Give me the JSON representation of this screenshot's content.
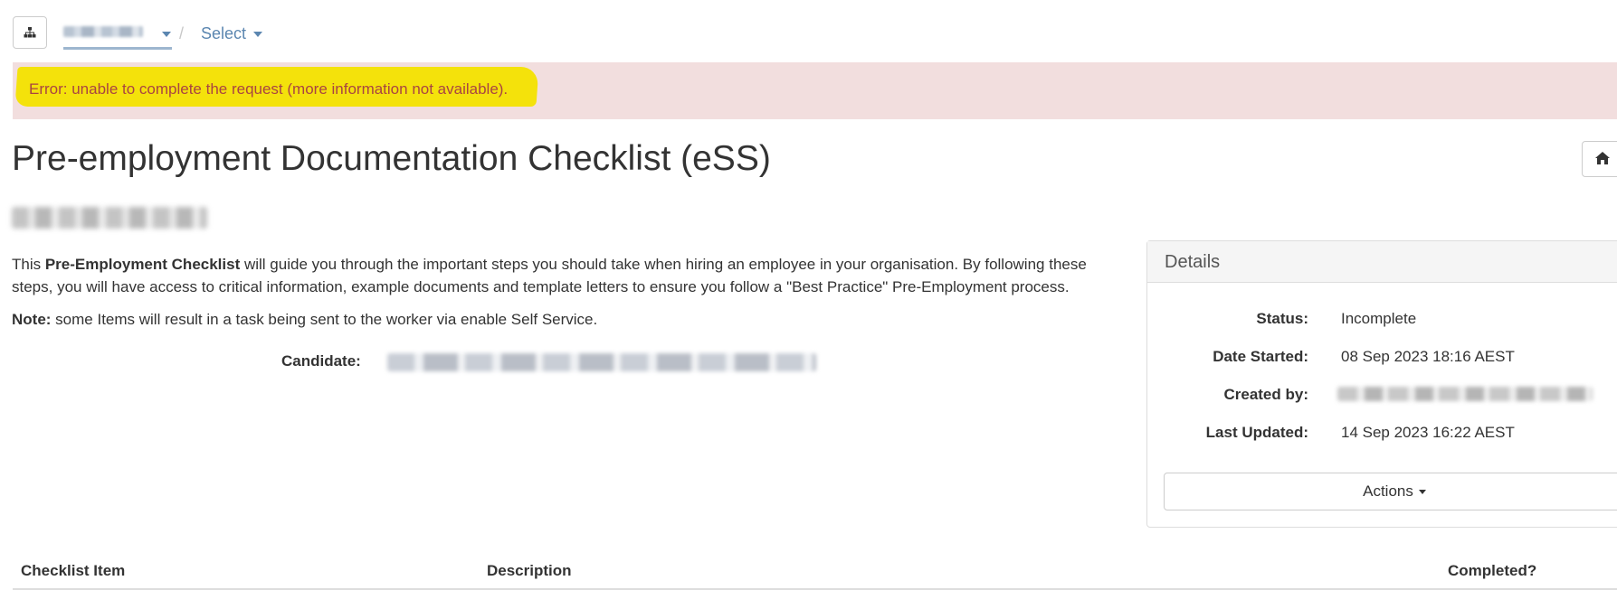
{
  "icons": {
    "org": "sitemap-icon",
    "home": "home-icon",
    "crumb_caret": "caret-down-icon",
    "actions_caret": "caret-down-icon"
  },
  "breadcrumb": {
    "separator": "/",
    "select_label": "Select"
  },
  "alert": {
    "message": "Error: unable to complete the request (more information not available)."
  },
  "page": {
    "title": "Pre-employment Documentation Checklist (eSS)"
  },
  "intro": {
    "prefix": "This ",
    "bold": "Pre-Employment Checklist",
    "rest": " will guide you through the important steps you should take when hiring an employee in your organisation. By following these steps, you will have access to critical information, example documents and template letters to ensure you follow a \"Best Practice\" Pre-Employment process."
  },
  "note": {
    "label": "Note:",
    "text": " some Items will result in a task being sent to the worker via enable Self Service."
  },
  "candidate": {
    "label": "Candidate:"
  },
  "details": {
    "heading": "Details",
    "status_label": "Status:",
    "status_value": "Incomplete",
    "date_started_label": "Date Started:",
    "date_started_value": "08 Sep 2023 18:16 AEST",
    "created_by_label": "Created by:",
    "last_updated_label": "Last Updated:",
    "last_updated_value": "14 Sep 2023 16:22 AEST",
    "actions_label": "Actions"
  },
  "table": {
    "columns": [
      "Checklist Item",
      "Description",
      "Completed?"
    ]
  },
  "colors": {
    "alert_bg": "#f2dede",
    "alert_text": "#a94442",
    "highlight": "#f4e20b",
    "link": "#5b86b0"
  }
}
